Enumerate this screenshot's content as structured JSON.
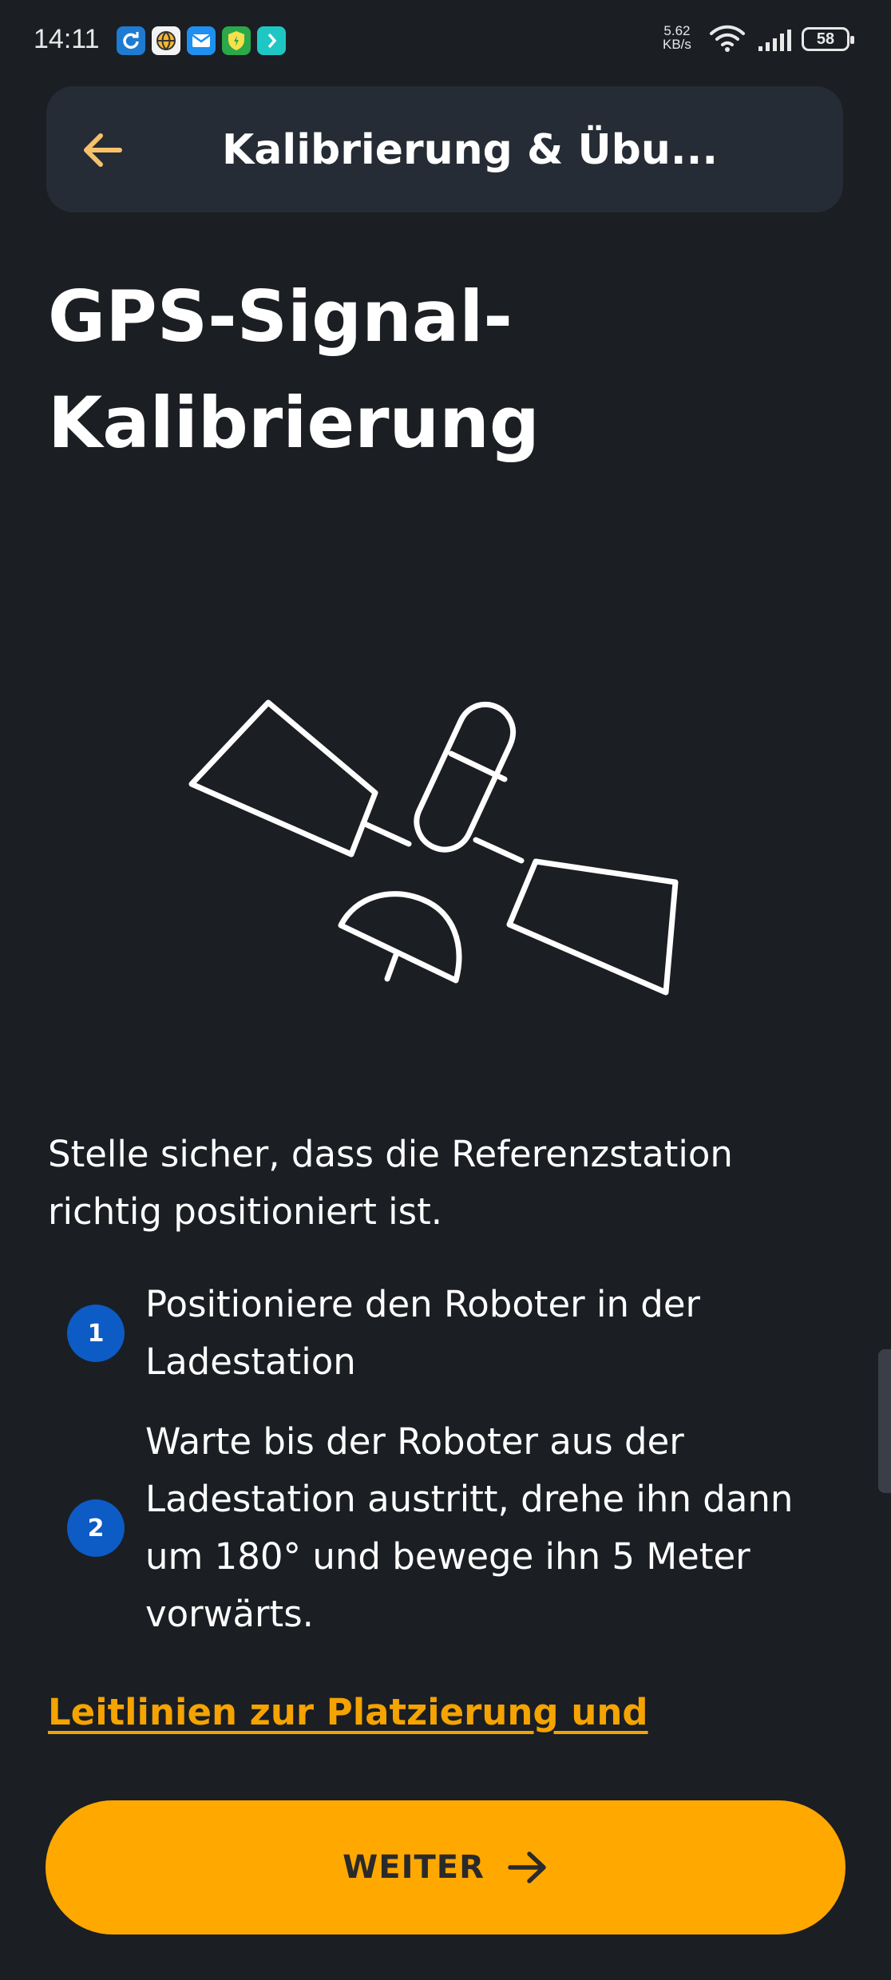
{
  "status_bar": {
    "time": "14:11",
    "net_speed_value": "5.62",
    "net_speed_unit": "KB/s",
    "battery": "58",
    "notification_icons": [
      "sync-icon",
      "globe-icon",
      "mail-icon",
      "shield-icon",
      "swiftkey-icon"
    ]
  },
  "header": {
    "title": "Kalibrierung & Übu...",
    "back_icon": "arrow-left-icon",
    "back_icon_color": "#f5c26b"
  },
  "page": {
    "title": "GPS-Signal-Kalibrierung",
    "illustration": "satellite-icon",
    "intro": "Stelle sicher, dass die Referenzstation richtig positioniert ist.",
    "steps": [
      {
        "number": "1",
        "text": "Positioniere den Roboter in der Ladestation"
      },
      {
        "number": "2",
        "text": "Warte bis der Roboter aus der Ladestation austritt, drehe ihn dann um 180° und bewege ihn 5 Meter vorwärts."
      }
    ],
    "guide_link": "Leitlinien zur Platzierung und"
  },
  "cta": {
    "label": "WEITER",
    "icon": "arrow-right-icon"
  },
  "colors": {
    "background": "#1b1e23",
    "header_bg": "#262c35",
    "accent": "#ffa800",
    "link": "#f5a300",
    "step_badge": "#0d5bc4"
  }
}
